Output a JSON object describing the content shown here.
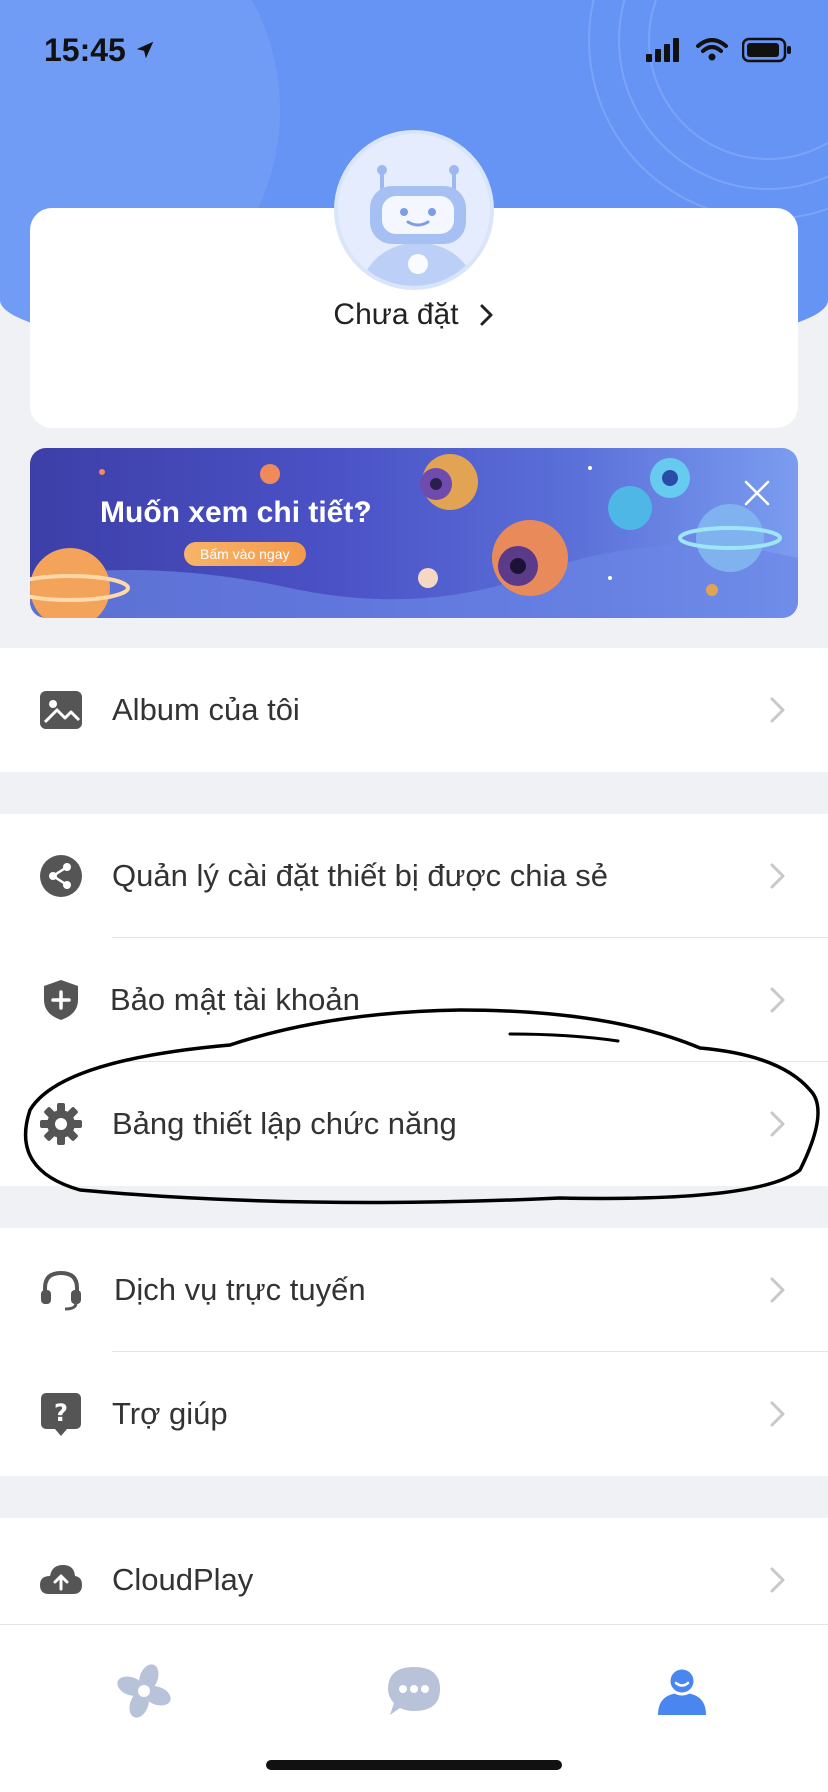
{
  "status_bar": {
    "time": "15:45"
  },
  "profile": {
    "name": "Chưa đặt"
  },
  "banner": {
    "title": "Muốn xem chi tiết?",
    "button_label": "Bấm vào ngay"
  },
  "menu": {
    "album": {
      "label": "Album của tôi",
      "icon": "image-icon"
    },
    "shared_devices": {
      "label": "Quản lý cài đặt thiết bị được chia sẻ",
      "icon": "share-icon"
    },
    "account_security": {
      "label": "Bảo mật tài khoản",
      "icon": "shield-icon"
    },
    "function_settings": {
      "label": "Bảng thiết lập chức năng",
      "icon": "gear-icon"
    },
    "online_service": {
      "label": "Dịch vụ trực tuyến",
      "icon": "headset-icon"
    },
    "help": {
      "label": "Trợ giúp",
      "icon": "help-icon"
    },
    "cloudplay": {
      "label": "CloudPlay",
      "icon": "cloud-upload-icon"
    }
  },
  "bottom_nav": {
    "items": [
      {
        "icon": "flower-logo-icon",
        "active": false
      },
      {
        "icon": "chat-icon",
        "active": false
      },
      {
        "icon": "person-icon",
        "active": true
      }
    ]
  },
  "colors": {
    "hero": "#6594f5",
    "accent": "#4a86f0",
    "icon_gray": "#555555"
  }
}
